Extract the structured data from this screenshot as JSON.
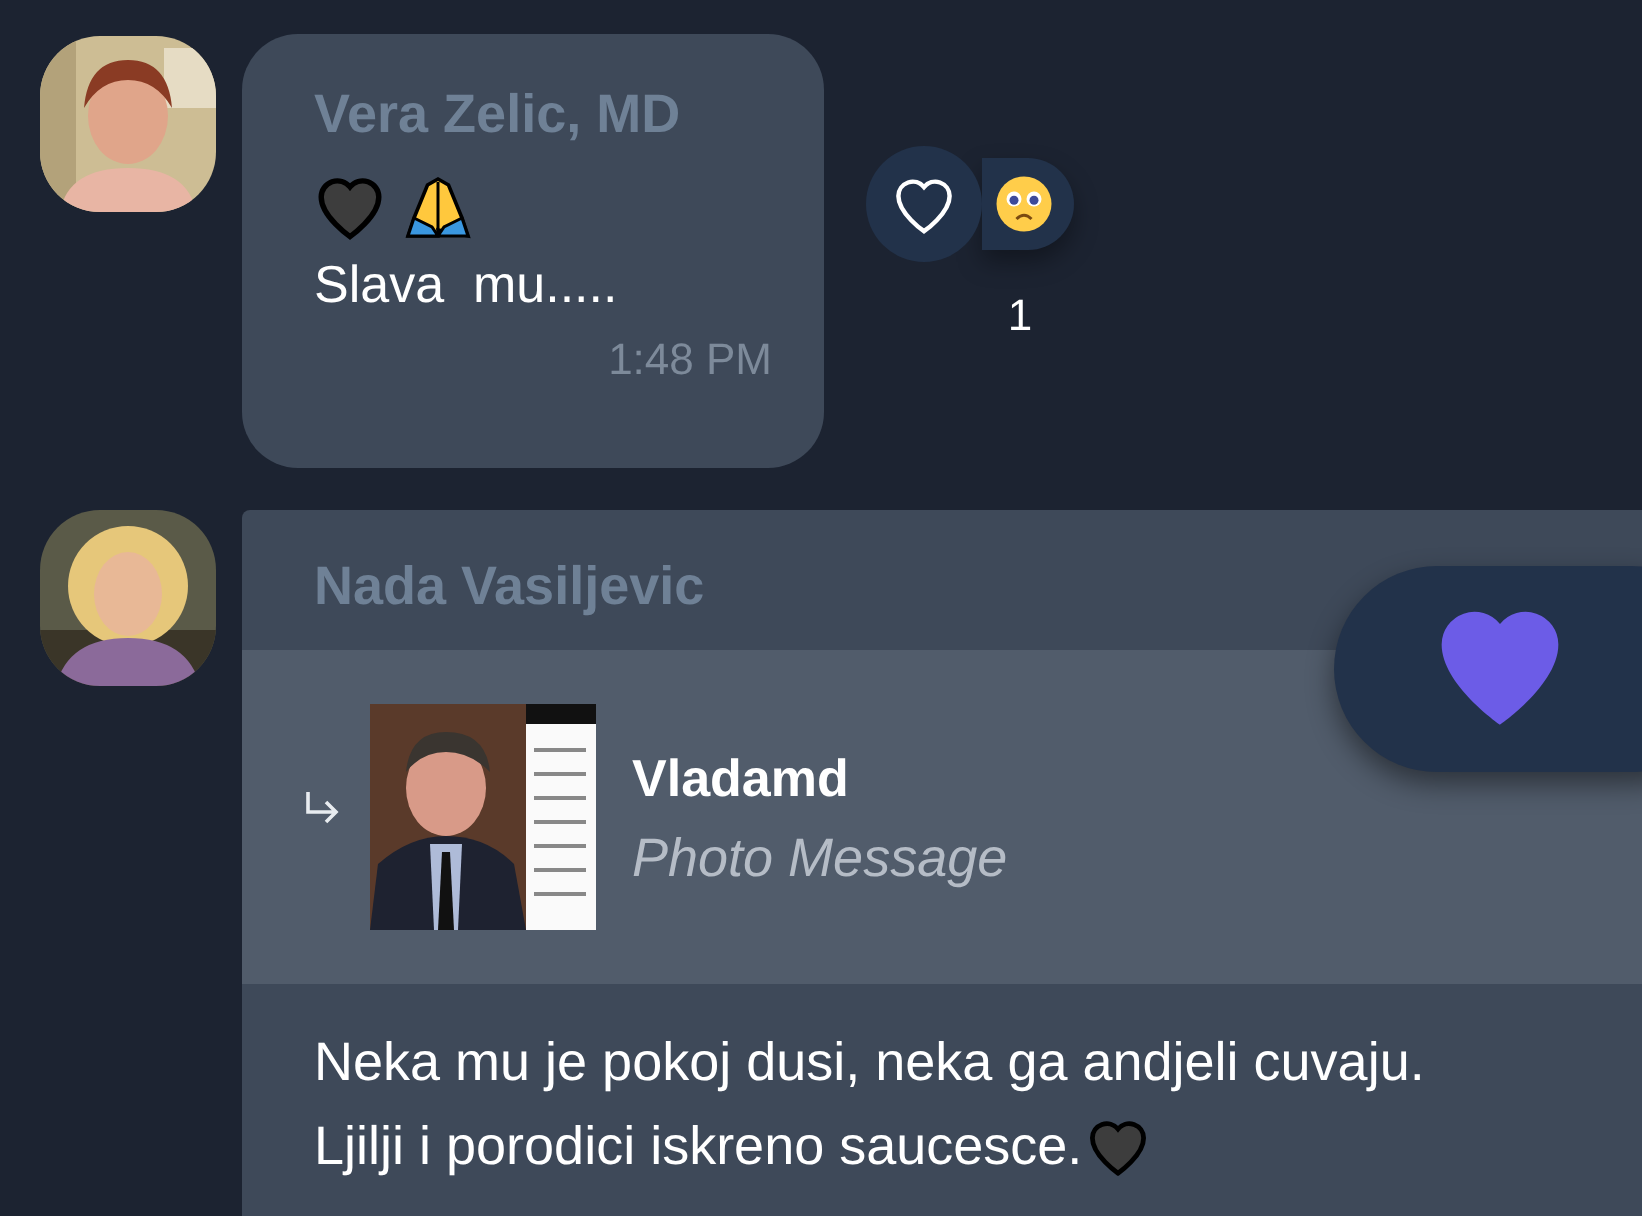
{
  "messages": [
    {
      "author": "Vera Zelic, MD",
      "text": "Slava  mu.....",
      "time": "1:48 PM",
      "reactions": [
        {
          "count": "1"
        }
      ]
    },
    {
      "author": "Nada Vasiljevic",
      "reply": {
        "author": "Vladamd",
        "preview": "Photo Message"
      },
      "lines": [
        "Neka mu je pokoj dusi, neka ga andjeli cuvaju.",
        "Ljilji i porodici iskreno saucesce."
      ]
    }
  ]
}
